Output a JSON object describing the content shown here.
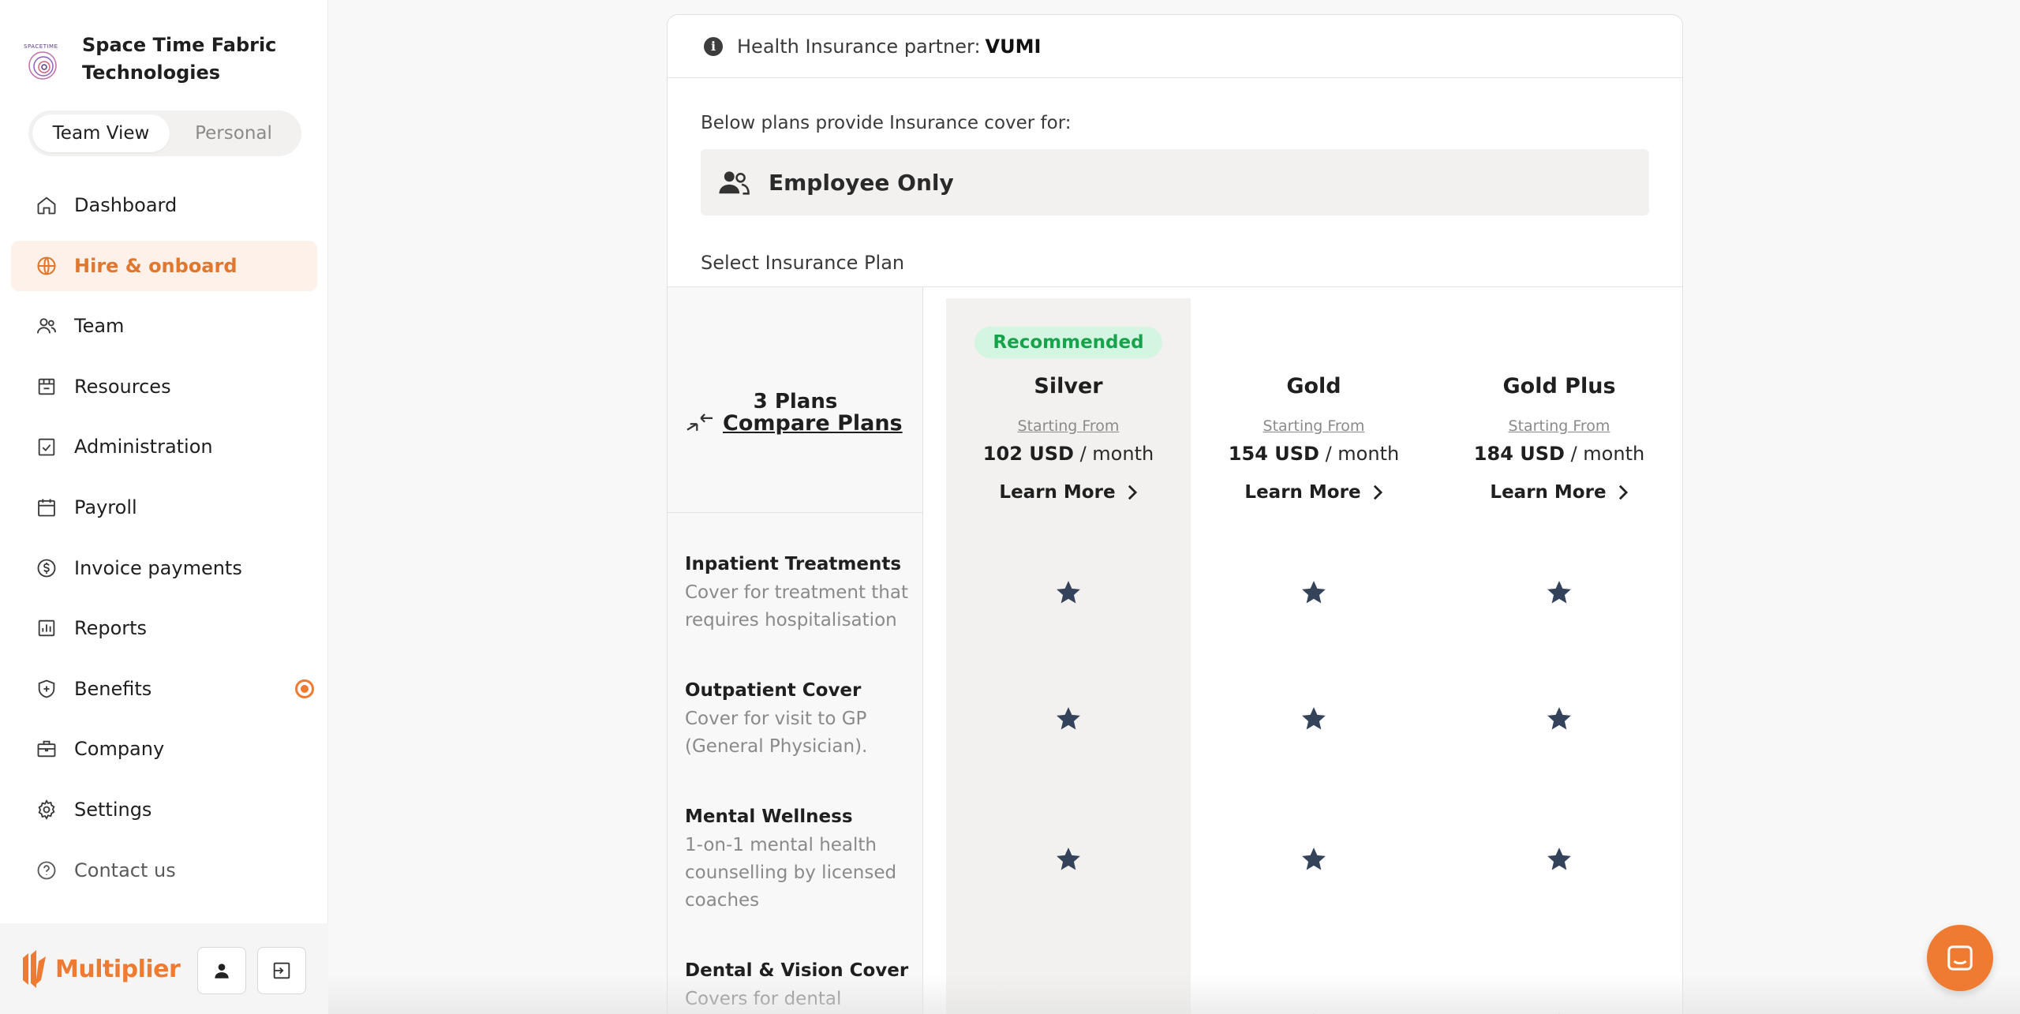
{
  "org": {
    "name": "Space Time Fabric Technologies",
    "logo_text": "SPACETIME"
  },
  "view_toggle": {
    "team": "Team View",
    "personal": "Personal"
  },
  "nav": [
    {
      "label": "Dashboard",
      "icon": "home-icon"
    },
    {
      "label": "Hire & onboard",
      "icon": "globe-icon",
      "active": true
    },
    {
      "label": "Team",
      "icon": "users-icon"
    },
    {
      "label": "Resources",
      "icon": "box-icon"
    },
    {
      "label": "Administration",
      "icon": "clipboard-check-icon"
    },
    {
      "label": "Payroll",
      "icon": "calendar-icon"
    },
    {
      "label": "Invoice payments",
      "icon": "dollar-circle-icon"
    },
    {
      "label": "Reports",
      "icon": "bar-chart-icon"
    },
    {
      "label": "Benefits",
      "icon": "shield-plus-icon",
      "badge": true
    },
    {
      "label": "Company",
      "icon": "briefcase-icon"
    },
    {
      "label": "Settings",
      "icon": "gear-icon"
    },
    {
      "label": "Contact us",
      "icon": "question-circle-icon"
    }
  ],
  "brand": {
    "name": "Multiplier"
  },
  "partner": {
    "label": "Health Insurance partner:",
    "name": "VUMI"
  },
  "cover": {
    "label": "Below plans provide Insurance cover for:",
    "value": "Employee Only"
  },
  "select_label": "Select Insurance Plan",
  "plans_summary": {
    "count": "3 Plans",
    "compare": "Compare Plans"
  },
  "recommended_badge": "Recommended",
  "plans": [
    {
      "name": "Silver",
      "from": "Starting From",
      "amount": "102 USD",
      "period": " / month",
      "learn": "Learn More"
    },
    {
      "name": "Gold",
      "from": "Starting From",
      "amount": "154 USD",
      "period": " / month",
      "learn": "Learn More"
    },
    {
      "name": "Gold Plus",
      "from": "Starting From",
      "amount": "184 USD",
      "period": " / month",
      "learn": "Learn More"
    }
  ],
  "features": [
    {
      "title": "Inpatient Treatments",
      "desc": "Cover for treatment that requires hospitalisation"
    },
    {
      "title": "Outpatient Cover",
      "desc": "Cover for visit to GP (General Physician)."
    },
    {
      "title": "Mental Wellness",
      "desc": "1-on-1 mental health counselling by licensed coaches"
    },
    {
      "title": "Dental & Vision Cover",
      "desc": "Covers for dental expenses and provides"
    }
  ],
  "colors": {
    "accent": "#ef7a31",
    "recommended_bg": "#d3f5e1",
    "recommended_text": "#16a34a",
    "star": "#34425a"
  }
}
